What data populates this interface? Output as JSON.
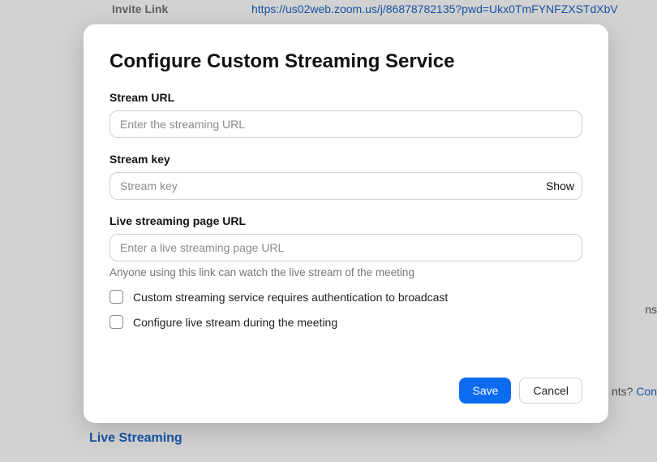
{
  "background": {
    "invite_link_label": "Invite Link",
    "invite_link_url": "https://us02web.zoom.us/j/86878782135?pwd=Ukx0TmFYNFZXSTdXbV",
    "side_text_1": "ns",
    "side_text_2_prefix": "nts? ",
    "side_text_2_link": "Con",
    "live_streaming_heading": "Live Streaming"
  },
  "modal": {
    "title": "Configure Custom Streaming Service",
    "stream_url": {
      "label": "Stream URL",
      "placeholder": "Enter the streaming URL",
      "value": ""
    },
    "stream_key": {
      "label": "Stream key",
      "placeholder": "Stream key",
      "value": "",
      "show_label": "Show"
    },
    "page_url": {
      "label": "Live streaming page URL",
      "placeholder": "Enter a live streaming page URL",
      "value": "",
      "help": "Anyone using this link can watch the live stream of the meeting"
    },
    "checkbox_auth": "Custom streaming service requires authentication to broadcast",
    "checkbox_during": "Configure live stream during the meeting",
    "save_label": "Save",
    "cancel_label": "Cancel"
  }
}
